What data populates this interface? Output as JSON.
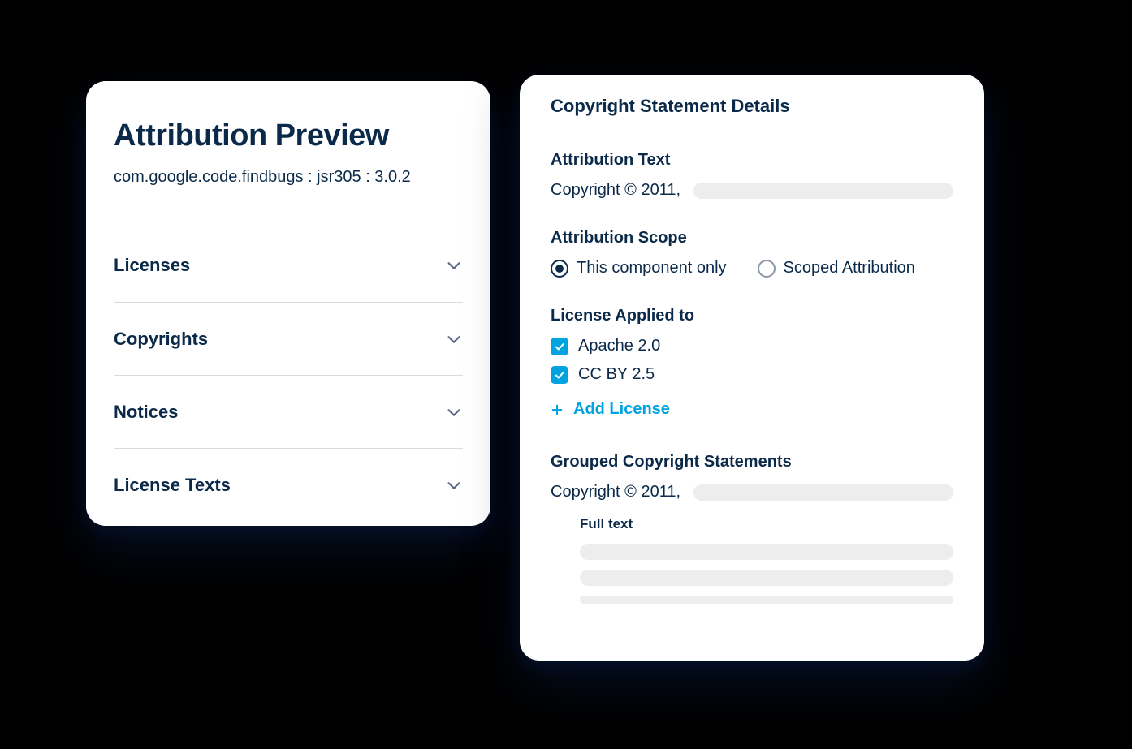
{
  "left": {
    "title": "Attribution Preview",
    "subtitle": "com.google.code.findbugs : jsr305 : 3.0.2",
    "accordion": [
      {
        "label": "Licenses"
      },
      {
        "label": "Copyrights"
      },
      {
        "label": "Notices"
      },
      {
        "label": "License Texts"
      }
    ]
  },
  "right": {
    "title": "Copyright Statement Details",
    "attribution_text_label": "Attribution Text",
    "attribution_text_value": "Copyright © 2011,",
    "scope_label": "Attribution Scope",
    "scope_options": {
      "this_only": "This component only",
      "scoped": "Scoped Attribution"
    },
    "license_applied_label": "License Applied to",
    "licenses": [
      {
        "name": "Apache 2.0",
        "checked": true
      },
      {
        "name": "CC BY 2.5",
        "checked": true
      }
    ],
    "add_license": "Add License",
    "grouped_label": "Grouped Copyright Statements",
    "grouped_value": "Copyright © 2011,",
    "full_text_label": "Full text"
  }
}
